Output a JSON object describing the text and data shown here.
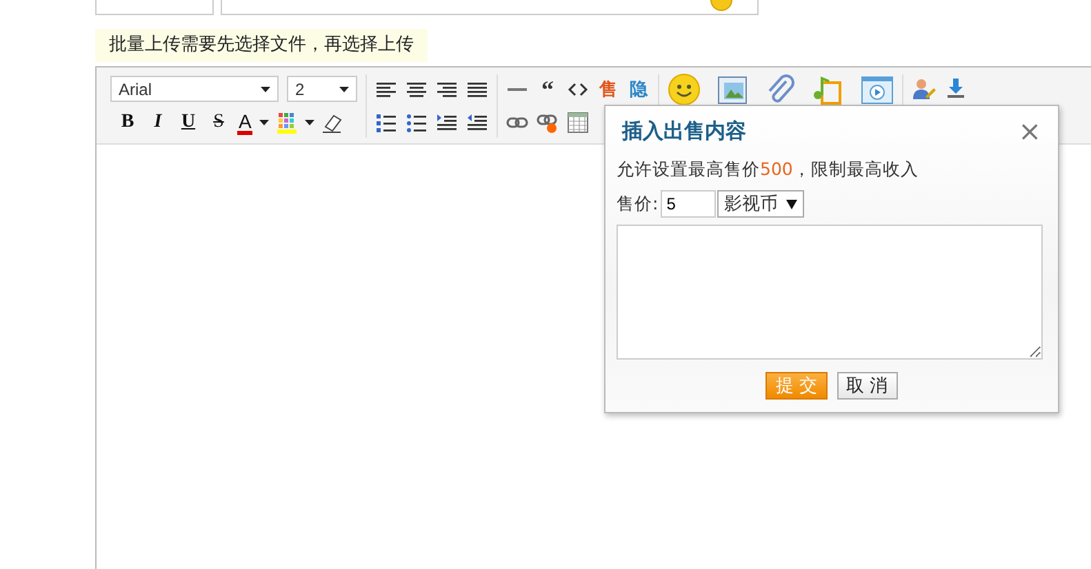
{
  "notice": "批量上传需要先选择文件，再选择上传",
  "toolbar": {
    "font": "Arial",
    "size": "2",
    "format_buttons": [
      {
        "label": "B",
        "kind": "bold"
      },
      {
        "label": "I",
        "kind": "italic"
      },
      {
        "label": "U",
        "kind": "underline"
      },
      {
        "label": "S",
        "kind": "strike"
      }
    ],
    "text_color_label": "A",
    "quote": "“",
    "sell": "售",
    "hide": "隐"
  },
  "dialog": {
    "title": "插入出售内容",
    "close": "×",
    "hint_before": "允许设置最高售价",
    "hint_amount": "500",
    "hint_after": "，限制最高收入",
    "price_label": "售价:",
    "price_value": "5",
    "currency": "影视币",
    "submit": "提 交",
    "cancel": "取 消"
  }
}
